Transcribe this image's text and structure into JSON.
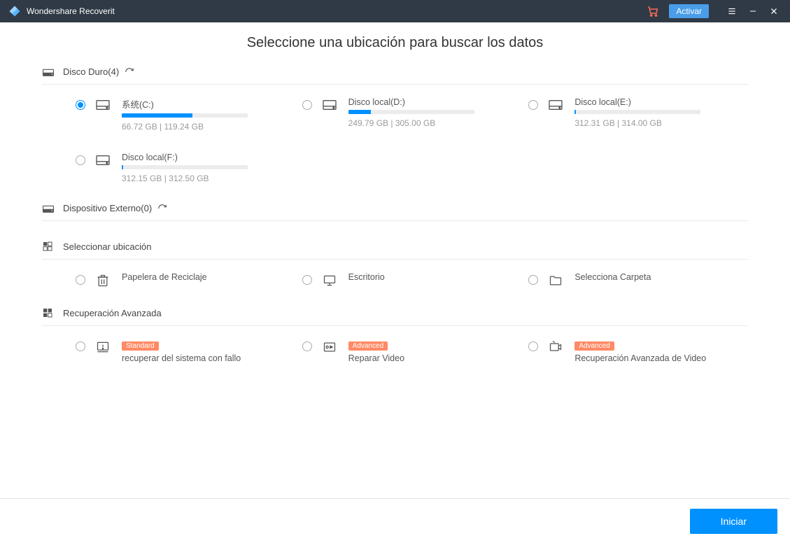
{
  "titlebar": {
    "app_name": "Wondershare Recoverit",
    "activate_label": "Activar"
  },
  "heading": "Seleccione una ubicación para buscar los datos",
  "sections": {
    "hdd": {
      "title": "Disco Duro(4)"
    },
    "external": {
      "title": "Dispositivo Externo(0)"
    },
    "select_loc": {
      "title": "Seleccionar ubicación"
    },
    "advanced": {
      "title": "Recuperación Avanzada"
    }
  },
  "drives": [
    {
      "name": "系统(C:)",
      "used": "66.72 GB",
      "total": "119.24 GB",
      "pct": 56,
      "selected": true
    },
    {
      "name": "Disco local(D:)",
      "used": "249.79 GB",
      "total": "305.00 GB",
      "pct": 18,
      "selected": false
    },
    {
      "name": "Disco local(E:)",
      "used": "312.31 GB",
      "total": "314.00 GB",
      "pct": 1,
      "selected": false
    },
    {
      "name": "Disco local(F:)",
      "used": "312.15 GB",
      "total": "312.50 GB",
      "pct": 1,
      "selected": false
    }
  ],
  "locations": [
    {
      "name": "Papelera de Reciclaje",
      "icon": "recycle"
    },
    {
      "name": "Escritorio",
      "icon": "desktop"
    },
    {
      "name": "Selecciona Carpeta",
      "icon": "folder"
    }
  ],
  "advanced_items": [
    {
      "name": "recuperar del sistema con fallo",
      "badge": "Standard",
      "icon": "crashed"
    },
    {
      "name": "Reparar Video",
      "badge": "Advanced",
      "icon": "repair"
    },
    {
      "name": "Recuperación Avanzada de Video",
      "badge": "Advanced",
      "icon": "adv-video"
    }
  ],
  "footer": {
    "start_label": "Iniciar"
  }
}
